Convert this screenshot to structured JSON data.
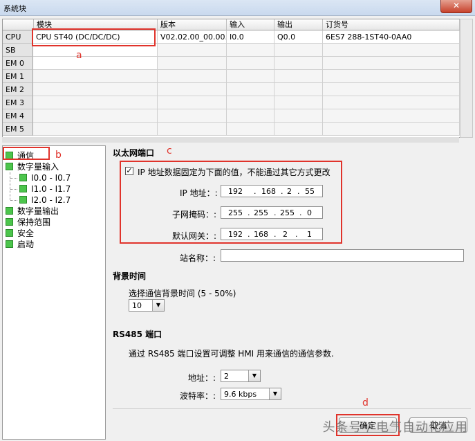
{
  "window": {
    "title": "系统块",
    "close_icon": "✕"
  },
  "table": {
    "headers": [
      "",
      "模块",
      "版本",
      "输入",
      "输出",
      "订货号"
    ],
    "rows": [
      {
        "label": "CPU",
        "module": "CPU ST40 (DC/DC/DC)",
        "version": "V02.02.00_00.00...",
        "input": "I0.0",
        "output": "Q0.0",
        "order": "6ES7 288-1ST40-0AA0"
      },
      {
        "label": "SB",
        "module": "",
        "version": "",
        "input": "",
        "output": "",
        "order": ""
      },
      {
        "label": "EM 0",
        "module": "",
        "version": "",
        "input": "",
        "output": "",
        "order": ""
      },
      {
        "label": "EM 1",
        "module": "",
        "version": "",
        "input": "",
        "output": "",
        "order": ""
      },
      {
        "label": "EM 2",
        "module": "",
        "version": "",
        "input": "",
        "output": "",
        "order": ""
      },
      {
        "label": "EM 3",
        "module": "",
        "version": "",
        "input": "",
        "output": "",
        "order": ""
      },
      {
        "label": "EM 4",
        "module": "",
        "version": "",
        "input": "",
        "output": "",
        "order": ""
      },
      {
        "label": "EM 5",
        "module": "",
        "version": "",
        "input": "",
        "output": "",
        "order": ""
      }
    ]
  },
  "annotations": {
    "a": "a",
    "b": "b",
    "c": "c",
    "d": "d"
  },
  "tree": {
    "items": [
      {
        "label": "通信"
      },
      {
        "label": "数字量输入"
      },
      {
        "label": "I0.0 - I0.7"
      },
      {
        "label": "I1.0 - I1.7"
      },
      {
        "label": "I2.0 - I2.7"
      },
      {
        "label": "数字量输出"
      },
      {
        "label": "保持范围"
      },
      {
        "label": "安全"
      },
      {
        "label": "启动"
      }
    ]
  },
  "ethernet": {
    "title": "以太网端口",
    "fixed_ip_checked": true,
    "fixed_ip_label": "IP 地址数据固定为下面的值，不能通过其它方式更改",
    "ip_label": "IP 地址：:",
    "ip": [
      "192",
      "168",
      "2",
      "55"
    ],
    "mask_label": "子网掩码：:",
    "mask": [
      "255",
      "255",
      "255",
      "0"
    ],
    "gateway_label": "默认网关：:",
    "gateway": [
      "192",
      "168",
      "2",
      "1"
    ],
    "station_label": "站名称：:",
    "station_value": ""
  },
  "background": {
    "title": "背景时间",
    "label": "选择通信背景时间 (5 - 50%)",
    "value": "10"
  },
  "rs485": {
    "title": "RS485 端口",
    "description": "通过 RS485 端口设置可调整 HMI 用来通信的通信参数.",
    "address_label": "地址：:",
    "address_value": "2",
    "baud_label": "波特率：:",
    "baud_value": "9.6 kbps"
  },
  "buttons": {
    "ok": "确定",
    "cancel": "取消"
  },
  "watermark": "头条号 / 电气自动化应用",
  "colors": {
    "highlight": "#e0332b",
    "tree_icon": "#4cc54c"
  }
}
